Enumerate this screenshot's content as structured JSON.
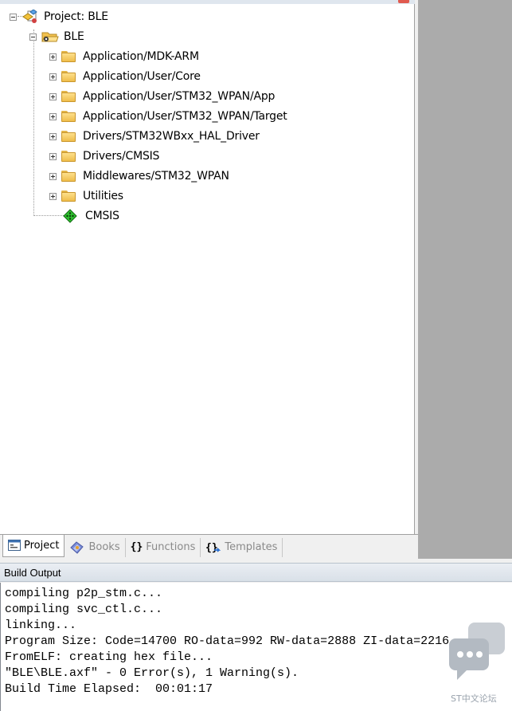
{
  "project_tree": {
    "root_label": "Project: BLE",
    "target_label": "BLE",
    "groups": [
      {
        "label": "Application/MDK-ARM"
      },
      {
        "label": "Application/User/Core"
      },
      {
        "label": "Application/User/STM32_WPAN/App"
      },
      {
        "label": "Application/User/STM32_WPAN/Target"
      },
      {
        "label": "Drivers/STM32WBxx_HAL_Driver"
      },
      {
        "label": "Drivers/CMSIS"
      },
      {
        "label": "Middlewares/STM32_WPAN"
      },
      {
        "label": "Utilities"
      }
    ],
    "component": {
      "label": "CMSIS",
      "icon": "green-diamond-component-icon"
    }
  },
  "tabs": [
    {
      "label": "Project",
      "icon": "project-window-icon",
      "active": true
    },
    {
      "label": "Books",
      "icon": "books-icon",
      "active": false
    },
    {
      "label": "Functions",
      "icon": "braces-icon",
      "active": false
    },
    {
      "label": "Templates",
      "icon": "templates-icon",
      "active": false
    }
  ],
  "build_output": {
    "title": "Build Output",
    "lines": [
      "compiling p2p_stm.c...",
      "compiling svc_ctl.c...",
      "linking...",
      "Program Size: Code=14700 RO-data=992 RW-data=2888 ZI-data=2216",
      "FromELF: creating hex file...",
      "\"BLE\\BLE.axf\" - 0 Error(s), 1 Warning(s).",
      "Build Time Elapsed:  00:01:17"
    ]
  },
  "watermark": {
    "text": "ST中文论坛",
    "icon": "chat-bubbles-icon"
  },
  "colors": {
    "editor_background": "#ababab",
    "panel_background": "#ffffff",
    "folder_yellow": "#f5cd62",
    "component_green": "#2fbf2f"
  }
}
